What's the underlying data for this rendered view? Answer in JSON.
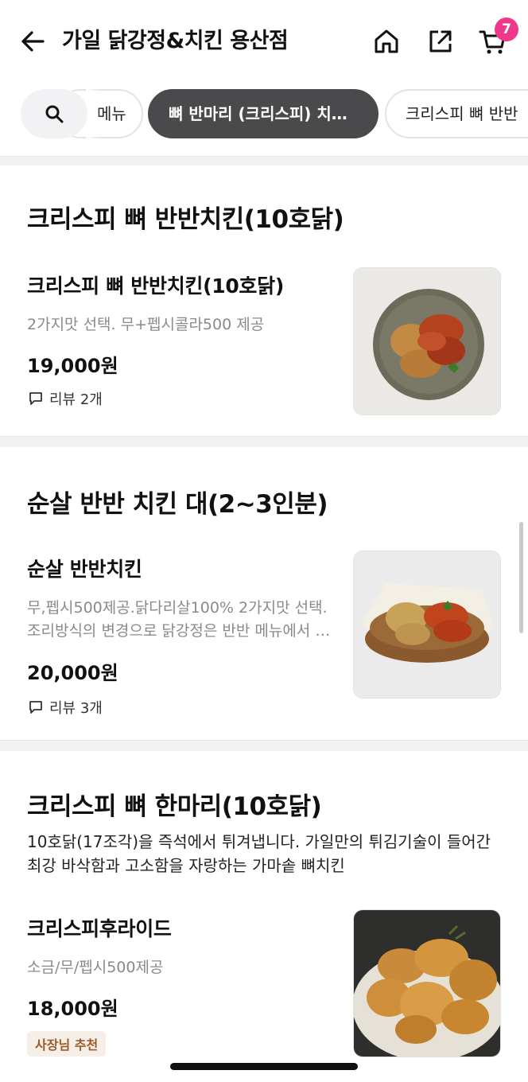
{
  "header": {
    "title": "가일 닭강정&치킨 용산점",
    "cart_count": "7"
  },
  "chips": {
    "items": [
      "메뉴",
      "뼈 반마리 (크리스피) 치…",
      "크리스피 뼈 반반"
    ],
    "active_index": 1
  },
  "sections": [
    {
      "title": "크리스피 뼈 반반치킨(10호닭)",
      "items": [
        {
          "name": "크리스피 뼈 반반치킨(10호닭)",
          "desc": "2가지맛 선택. 무+펩시콜라500 제공",
          "price": "19,000원",
          "review": "리뷰 2개"
        }
      ]
    },
    {
      "title": "순살 반반 치킨 대(2~3인분)",
      "items": [
        {
          "name": "순살 반반치킨",
          "desc": "무,펩시500제공.닭다리살100% 2가지맛 선택.  조리방식의 변경으로 닭강정은 반반 메뉴에서 제외됩니다",
          "price": "20,000원",
          "review": "리뷰 3개"
        }
      ]
    },
    {
      "title": "크리스피 뼈 한마리(10호닭)",
      "desc": "10호닭(17조각)을 즉석에서 튀겨냅니다. 가일만의 튀김기술이 들어간 최강 바삭함과 고소함을 자랑하는 가마솥 뼈치킨",
      "items": [
        {
          "name": "크리스피후라이드",
          "desc": "소금/무/펩시500제공",
          "price": "18,000원",
          "badge": "사장님 추천"
        }
      ]
    }
  ],
  "colors": {
    "badge": "#f0388a",
    "active_chip": "#4a4a4d",
    "owner_badge_bg": "#f6efe7",
    "owner_badge_text": "#9b5a2a"
  },
  "icons": [
    "back-arrow-icon",
    "home-icon",
    "share-icon",
    "cart-icon",
    "search-icon",
    "comment-icon"
  ]
}
